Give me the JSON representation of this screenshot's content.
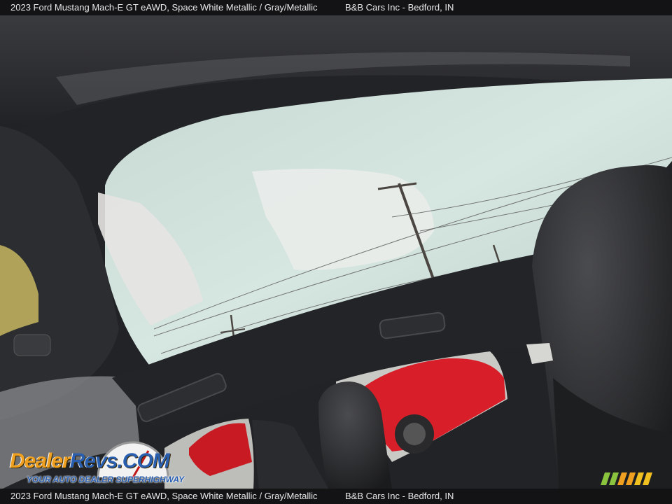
{
  "caption": {
    "vehicle": "2023 Ford Mustang Mach-E GT eAWD,  Space White Metallic / Gray/Metallic",
    "dealer": "B&B Cars Inc - Bedford, IN"
  },
  "watermark": {
    "brand_part1": "Dealer",
    "brand_part2": "Revs",
    "brand_part3": ".COM",
    "tagline": "YOUR AUTO DEALER SUPERHIGHWAY"
  },
  "colors": {
    "sky": "#cfe0db",
    "headliner": "#2a2b2e",
    "red_car": "#e0202a",
    "watermark_orange": "#f0a020",
    "watermark_blue": "#2a5fb0"
  }
}
